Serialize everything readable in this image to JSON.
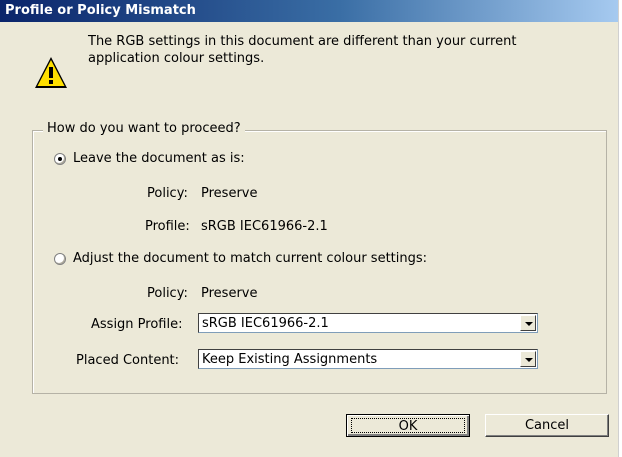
{
  "window": {
    "title": "Profile or Policy Mismatch"
  },
  "message": {
    "line1": "The RGB settings in this document are different than your current",
    "line2": "application colour settings."
  },
  "group": {
    "label": "How do you want to proceed?"
  },
  "option_leave": {
    "label": "Leave the document as is:",
    "selected": true,
    "policy_label": "Policy:",
    "policy_value": "Preserve",
    "profile_label": "Profile:",
    "profile_value": "sRGB IEC61966-2.1"
  },
  "option_adjust": {
    "label": "Adjust the document to match current colour settings:",
    "selected": false,
    "policy_label": "Policy:",
    "policy_value": "Preserve",
    "assign_label": "Assign Profile:",
    "assign_value": "sRGB IEC61966-2.1",
    "placed_label": "Placed Content:",
    "placed_value": "Keep Existing Assignments"
  },
  "buttons": {
    "ok": "OK",
    "cancel": "Cancel"
  },
  "icons": {
    "warning": "warning-triangle-icon",
    "dropdown": "chevron-down-icon"
  }
}
